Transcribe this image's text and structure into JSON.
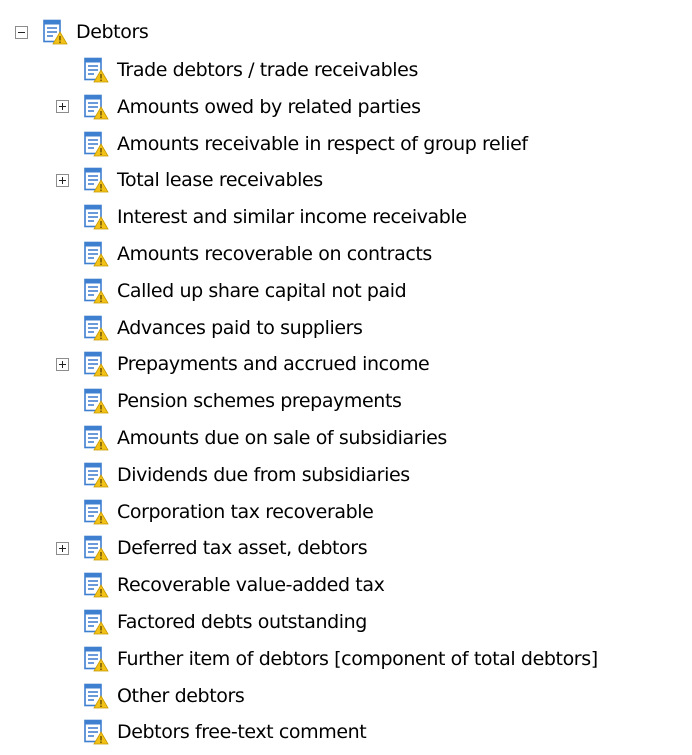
{
  "root": {
    "label": "Debtors",
    "expanded": true,
    "icon": "document-warning-icon"
  },
  "children": [
    {
      "label": "Trade debtors / trade receivables",
      "expandable": false
    },
    {
      "label": "Amounts owed by related parties",
      "expandable": true
    },
    {
      "label": "Amounts receivable in respect of group relief",
      "expandable": false
    },
    {
      "label": "Total lease receivables",
      "expandable": true
    },
    {
      "label": "Interest and similar income receivable",
      "expandable": false
    },
    {
      "label": "Amounts recoverable on contracts",
      "expandable": false
    },
    {
      "label": "Called up share capital not paid",
      "expandable": false
    },
    {
      "label": "Advances paid to suppliers",
      "expandable": false
    },
    {
      "label": "Prepayments and accrued income",
      "expandable": true
    },
    {
      "label": "Pension schemes prepayments",
      "expandable": false
    },
    {
      "label": "Amounts due on sale of subsidiaries",
      "expandable": false
    },
    {
      "label": "Dividends due from subsidiaries",
      "expandable": false
    },
    {
      "label": "Corporation tax recoverable",
      "expandable": false
    },
    {
      "label": "Deferred tax asset, debtors",
      "expandable": true
    },
    {
      "label": "Recoverable value-added tax",
      "expandable": false
    },
    {
      "label": "Factored debts outstanding",
      "expandable": false
    },
    {
      "label": "Further item of debtors [component of total debtors]",
      "expandable": false
    },
    {
      "label": "Other debtors",
      "expandable": false
    },
    {
      "label": "Debtors free-text comment",
      "expandable": false
    }
  ],
  "colors": {
    "icon_blue": "#3f7fd0",
    "icon_line": "#5b8fd6",
    "warning_yellow": "#f2c218",
    "expander_border": "#8c8c8c"
  }
}
